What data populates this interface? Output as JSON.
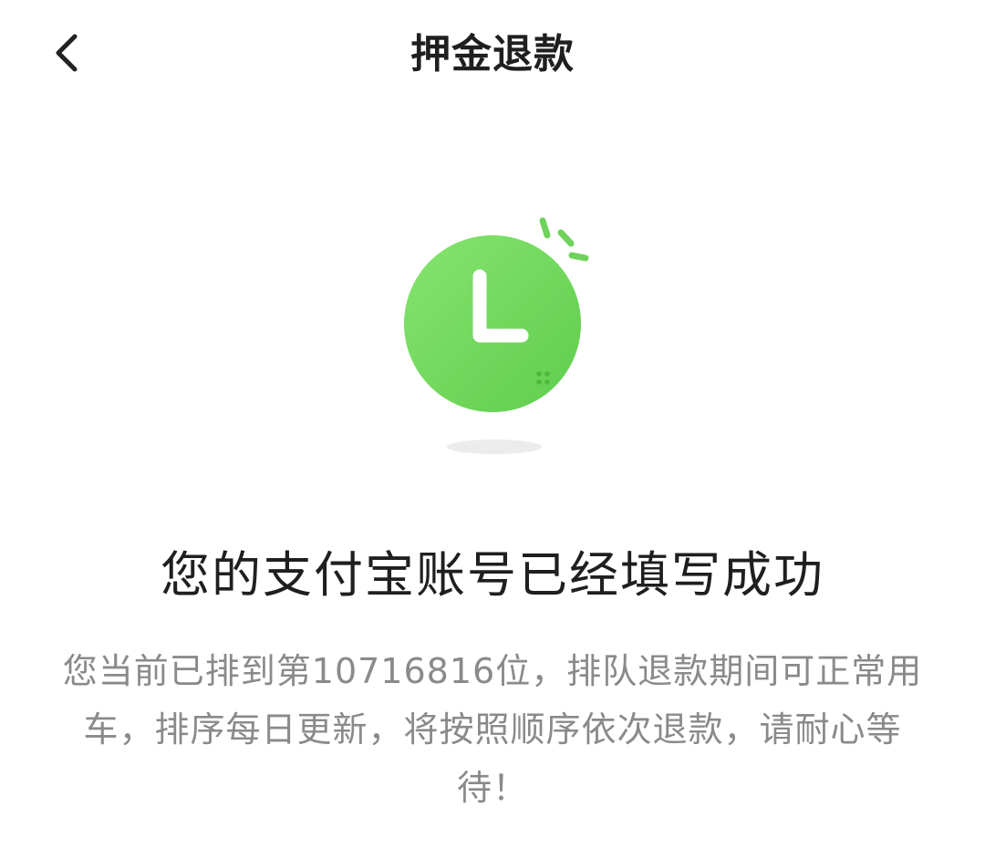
{
  "header": {
    "back_icon": "chevron-left-icon",
    "title": "押金退款"
  },
  "illustration": {
    "icon": "clock-icon",
    "accent_color": "#6fd35b"
  },
  "status": {
    "title": "您的支付宝账号已经填写成功",
    "description": "您当前已排到第10716816位，排队退款期间可正常用车，排序每日更新，将按照顺序依次退款，请耐心等待！"
  }
}
